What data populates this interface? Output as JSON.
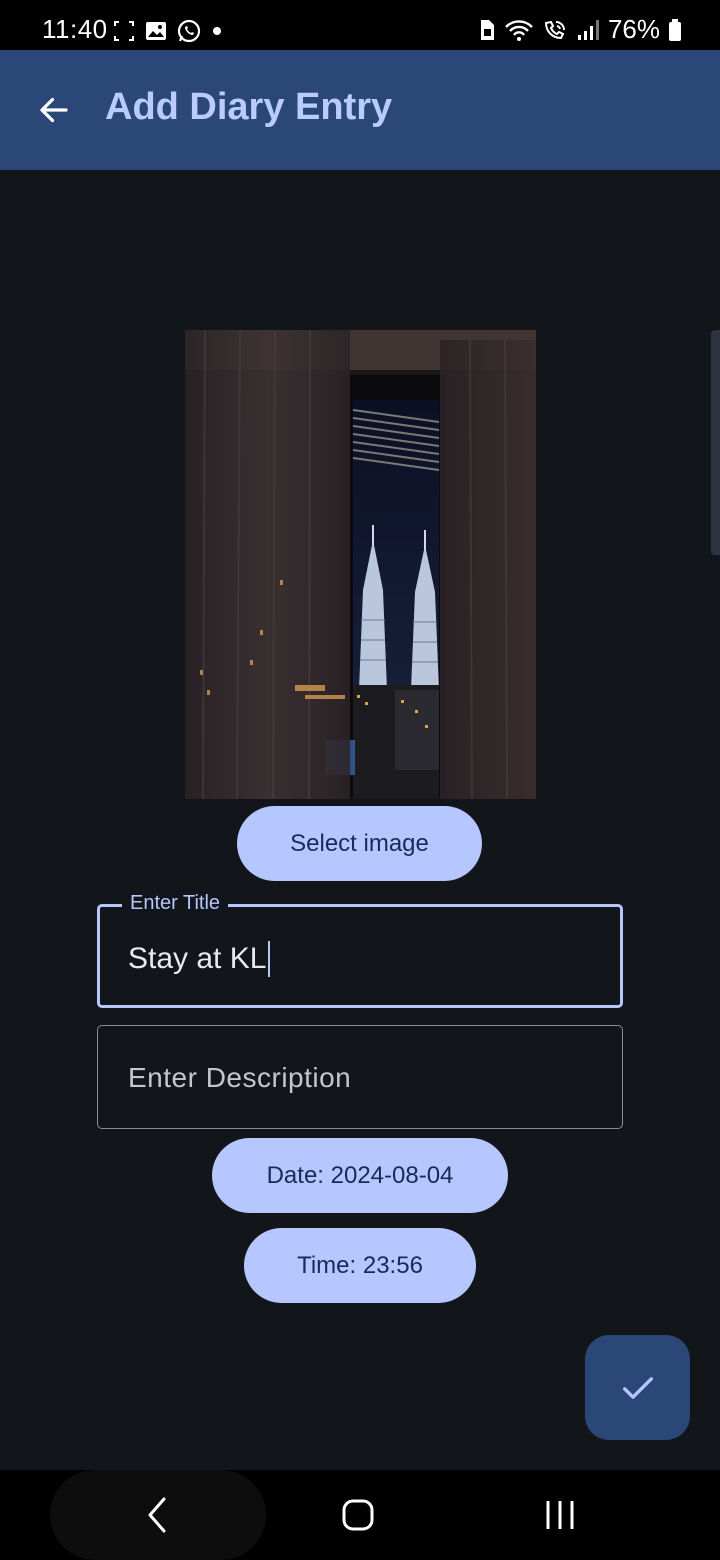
{
  "status_bar": {
    "time": "11:40",
    "battery": "76%",
    "icons": [
      "screenshot-icon",
      "gallery-icon",
      "whatsapp-icon",
      "dot-icon",
      "sim-icon",
      "wifi-icon",
      "wifi-call-icon",
      "signal-icon",
      "battery-icon"
    ]
  },
  "app_bar": {
    "title": "Add Diary Entry",
    "back_icon": "arrow-back-icon"
  },
  "form": {
    "select_image_label": "Select image",
    "title_field": {
      "label": "Enter Title",
      "value": "Stay at KL"
    },
    "description_field": {
      "placeholder": "Enter Description",
      "value": ""
    },
    "date_label": "Date: 2024-08-04",
    "time_label": "Time: 23:56",
    "save_icon": "check-icon"
  },
  "colors": {
    "app_bar_bg": "#2b4778",
    "accent": "#b6c7ff",
    "background": "#121519"
  },
  "nav_bar": {
    "icons": [
      "nav-back-icon",
      "nav-home-icon",
      "nav-recents-icon"
    ]
  }
}
